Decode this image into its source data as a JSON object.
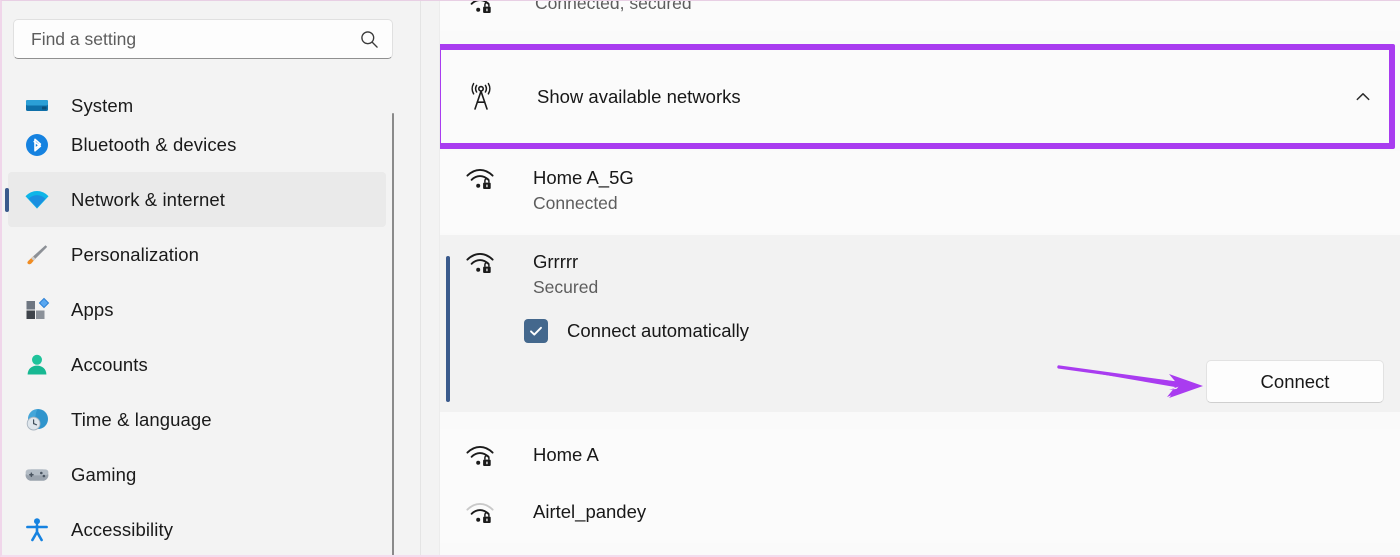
{
  "colors": {
    "accent_highlight": "#a93cf0",
    "selection_bar": "#3a5a8c",
    "checkbox_fill": "#44688d",
    "sidebar_bg": "#f3f3f3",
    "content_bg": "#fafafa",
    "row_selected_bg": "#f2f2f2"
  },
  "sidebar": {
    "search": {
      "placeholder": "Find a setting",
      "value": "",
      "icon": "search-icon"
    },
    "items": [
      {
        "label": "System",
        "icon": "system-icon",
        "selected": false
      },
      {
        "label": "Bluetooth & devices",
        "icon": "bluetooth-icon",
        "selected": false
      },
      {
        "label": "Network & internet",
        "icon": "wifi-icon",
        "selected": true
      },
      {
        "label": "Personalization",
        "icon": "paintbrush-icon",
        "selected": false
      },
      {
        "label": "Apps",
        "icon": "apps-icon",
        "selected": false
      },
      {
        "label": "Accounts",
        "icon": "person-icon",
        "selected": false
      },
      {
        "label": "Time & language",
        "icon": "clock-globe-icon",
        "selected": false
      },
      {
        "label": "Gaming",
        "icon": "gamepad-icon",
        "selected": false
      },
      {
        "label": "Accessibility",
        "icon": "accessibility-icon",
        "selected": false
      }
    ]
  },
  "content": {
    "top_partial_row": {
      "status": "Connected, secured",
      "icon": "wifi-lock-icon"
    },
    "show_available_networks": {
      "label": "Show available networks",
      "icon": "broadcast-tower-icon",
      "expand_icon": "chevron-up-icon",
      "expanded": true,
      "highlighted": true
    },
    "networks": [
      {
        "name": "Home A_5G",
        "status": "Connected",
        "icon": "wifi-lock-icon",
        "signal": "full",
        "expanded": false
      },
      {
        "name": "Grrrrr",
        "status": "Secured",
        "icon": "wifi-lock-icon",
        "signal": "full",
        "expanded": true,
        "connect_automatically_label": "Connect automatically",
        "connect_automatically_checked": true,
        "connect_button_label": "Connect"
      },
      {
        "name": "Home A",
        "status": "",
        "icon": "wifi-lock-icon",
        "signal": "full",
        "expanded": false
      },
      {
        "name": "Airtel_pandey",
        "status": "",
        "icon": "wifi-lock-icon",
        "signal": "medium",
        "expanded": false
      }
    ],
    "annotation": {
      "type": "arrow",
      "points_to": "Connect",
      "color": "#a93cf0"
    }
  }
}
